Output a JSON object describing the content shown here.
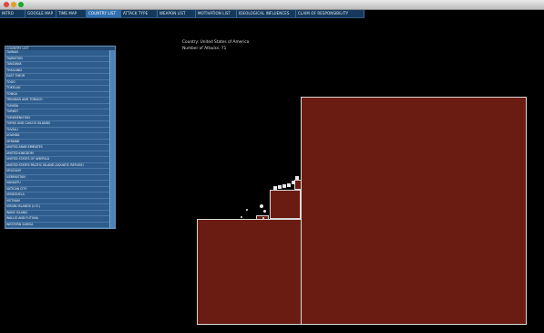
{
  "menu": [
    {
      "label": "INTRO"
    },
    {
      "label": "GOOGLE MAP"
    },
    {
      "label": "TIME MAP"
    },
    {
      "label": "COUNTRY LIST",
      "active": true
    },
    {
      "label": "ATTACK TYPE"
    },
    {
      "label": "WEAPON LIST"
    },
    {
      "label": "MOTIVATION LIST"
    },
    {
      "label": "IDEOLOGICAL INFLUENCES"
    },
    {
      "label": "CLAIM OF RESPONSIBILITY"
    }
  ],
  "country_panel": {
    "header": "COUNTRY LIST",
    "items": [
      "TAIWAN",
      "TAJIKISTAN",
      "TANZANIA",
      "THAILAND",
      "EAST TIMOR",
      "TOGO",
      "TOKELAU",
      "TONGA",
      "TRINIDAD AND TOBAGO",
      "TUNISIA",
      "TURKEY",
      "TURKMENISTAN",
      "TURKS AND CAICOS ISLANDS",
      "TUVALU",
      "UGANDA",
      "UKRAINE",
      "UNITED ARAB EMIRATES",
      "UNITED KINGDOM",
      "UNITED STATES OF AMERICA",
      "UNITED STATES PACIFIC ISLAND (AQUATIC REFUGE)",
      "URUGUAY",
      "UZBEKISTAN",
      "VANUATU",
      "VATICAN CITY",
      "VENEZUELA",
      "VIETNAM",
      "VIRGIN ISLANDS (U.S.)",
      "WAKE ISLAND",
      "WALLIS AND FUTUNA",
      "WESTERN SAMOA"
    ]
  },
  "info": {
    "country_line": "Country: United States of America",
    "attacks_line": "Number of Attacks: 71"
  },
  "colors": {
    "rect_fill": "#6b1c12",
    "menu_bg": "#15395c",
    "active_tab": "#2f6fb1"
  }
}
